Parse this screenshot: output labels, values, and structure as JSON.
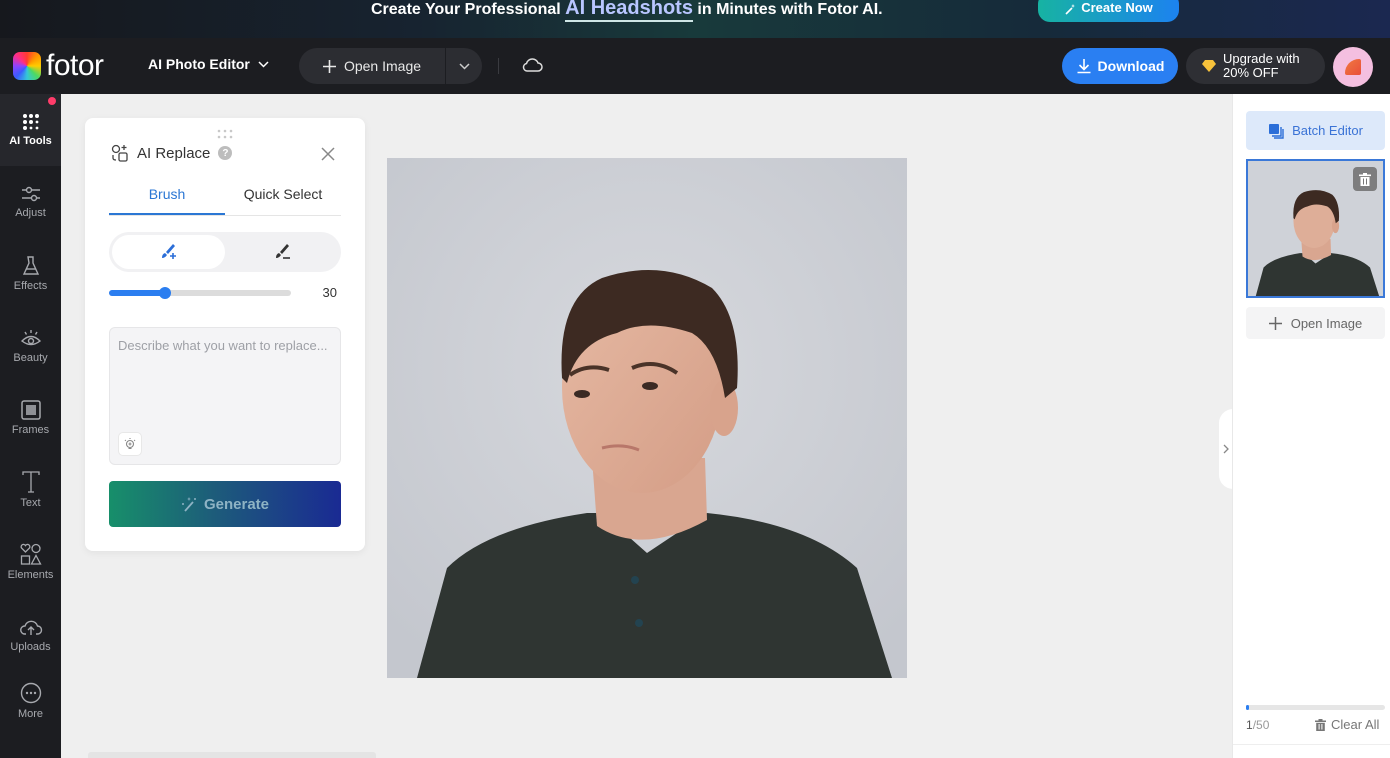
{
  "banner": {
    "text_before": "Create Your Professional",
    "highlight": "AI Headshots",
    "text_after": "in Minutes with Fotor AI.",
    "cta_label": "Create Now"
  },
  "topbar": {
    "logo_text": "fotor",
    "editor_menu_label": "AI Photo Editor",
    "open_image_label": "Open Image",
    "download_label": "Download",
    "upgrade_line1": "Upgrade with",
    "upgrade_line2": "20% OFF"
  },
  "sidebar": {
    "items": [
      {
        "label": "AI Tools",
        "icon": "grid-dots-icon",
        "active": true,
        "badge": true
      },
      {
        "label": "Adjust",
        "icon": "sliders-icon"
      },
      {
        "label": "Effects",
        "icon": "flask-icon"
      },
      {
        "label": "Beauty",
        "icon": "eye-icon"
      },
      {
        "label": "Frames",
        "icon": "frame-icon"
      },
      {
        "label": "Text",
        "icon": "text-icon"
      },
      {
        "label": "Elements",
        "icon": "shapes-icon"
      },
      {
        "label": "Uploads",
        "icon": "cloud-upload-icon"
      },
      {
        "label": "More",
        "icon": "more-icon"
      }
    ]
  },
  "panel": {
    "title": "AI Replace",
    "tabs": [
      {
        "label": "Brush",
        "active": true
      },
      {
        "label": "Quick Select",
        "active": false
      }
    ],
    "modes": [
      "brush-add",
      "brush-erase"
    ],
    "brush_size": {
      "value": "30",
      "fraction": 0.31
    },
    "prompt_placeholder": "Describe what you want to replace...",
    "prompt_value": "",
    "generate_label": "Generate"
  },
  "right_sidebar": {
    "batch_editor_label": "Batch Editor",
    "open_image_label": "Open Image",
    "count_current": "1",
    "count_total": "/50",
    "count_fraction": 0.02,
    "clear_all_label": "Clear All"
  },
  "colors": {
    "accent": "#2b7ef0",
    "tab_active": "#2b77d4",
    "badge": "#ff3c6a"
  }
}
